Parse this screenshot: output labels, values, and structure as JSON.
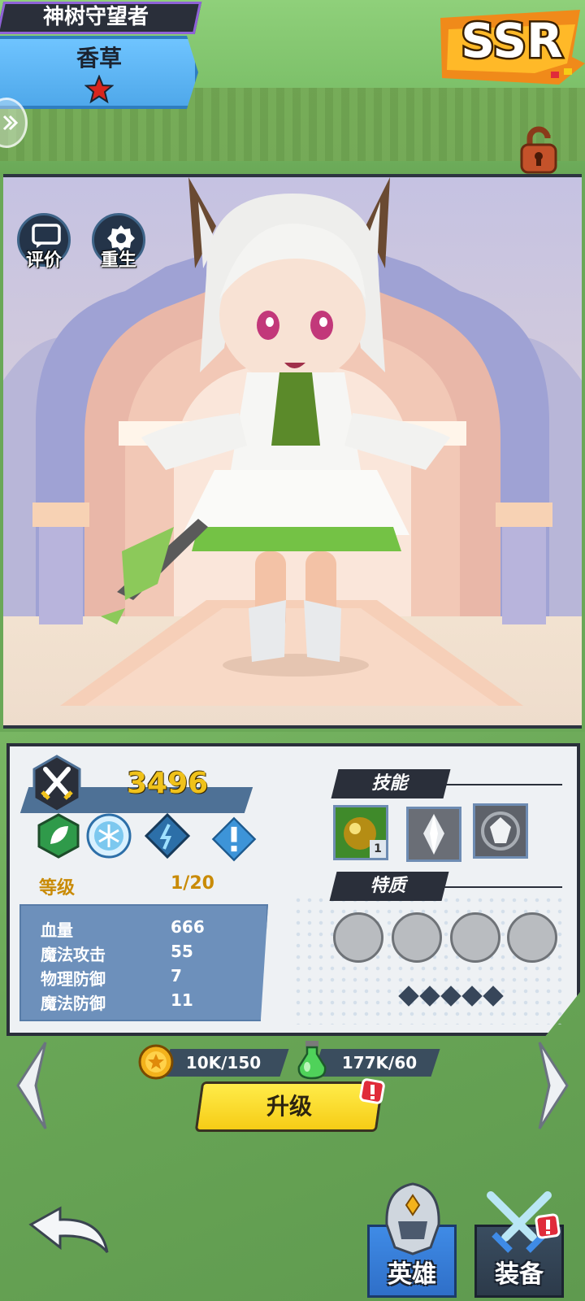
{
  "header": {
    "title": "神树守望者",
    "hero_name": "香草",
    "rarity": "SSR",
    "stars": 1
  },
  "stage": {
    "rate_label": "评价",
    "rebirth_label": "重生"
  },
  "panel": {
    "power": "3496",
    "attributes": [
      "leaf-icon",
      "snowflake-icon",
      "magic-crystal-icon",
      "info-icon"
    ],
    "level_label": "等级",
    "level_value": "1/20",
    "stats": [
      {
        "name": "血量",
        "value": "666"
      },
      {
        "name": "魔法攻击",
        "value": "55"
      },
      {
        "name": "物理防御",
        "value": "7"
      },
      {
        "name": "魔法防御",
        "value": "11"
      }
    ],
    "skills_header": "技能",
    "skills": [
      {
        "icon": "golden-orb-icon",
        "level": "1"
      },
      {
        "icon": "silver-crystal-icon"
      },
      {
        "icon": "white-gem-icon"
      }
    ],
    "traits_header": "特质",
    "trait_slots": 4,
    "diamond_count": 5
  },
  "currency": {
    "gold": "10K/150",
    "potion": "177K/60"
  },
  "upgrade_button": "升级",
  "nav": {
    "hero": "英雄",
    "equipment": "装备"
  },
  "colors": {
    "accent_yellow": "#f6cc16",
    "panel_dark": "#2a2f3a",
    "stats_blue": "#6d90bb",
    "power_gold": "#f0c21b",
    "level_gold": "#c98b07",
    "alert_red": "#e02b3a"
  }
}
